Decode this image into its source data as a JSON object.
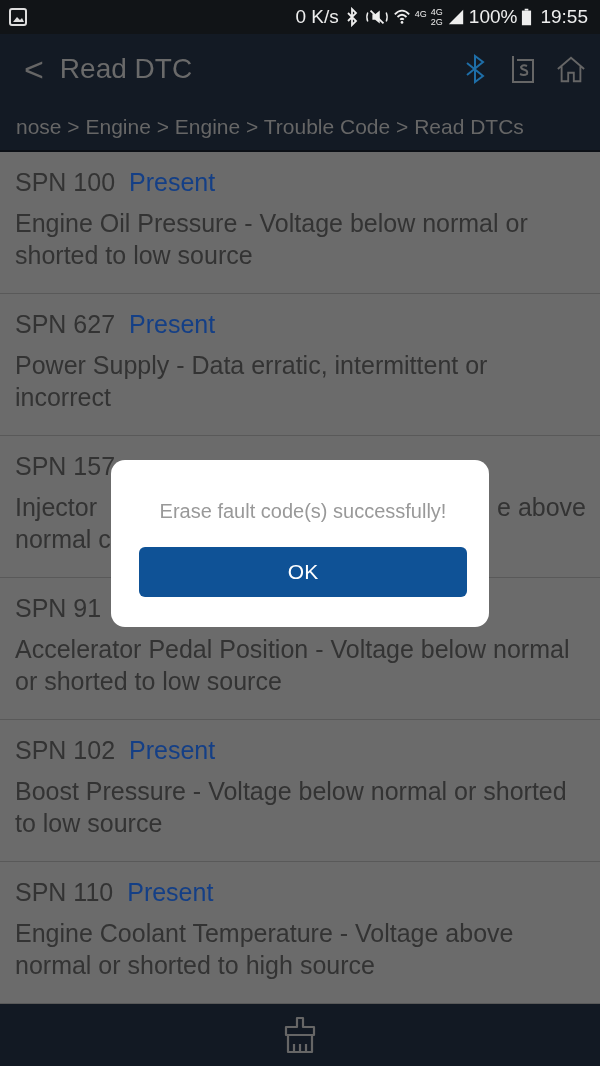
{
  "status_bar": {
    "speed": "0 K/s",
    "network_1": "4G",
    "network_2_top": "4G",
    "network_2_bottom": "2G",
    "battery": "100%",
    "time": "19:55"
  },
  "header": {
    "back_icon": "<",
    "title": "Read DTC",
    "bluetooth_connected": true
  },
  "breadcrumb": "nose > Engine > Engine > Trouble Code > Read DTCs",
  "codes": [
    {
      "kind": "full",
      "code": "SPN 100",
      "status": "Present",
      "description": "Engine Oil Pressure - Voltage below normal or shorted to low source"
    },
    {
      "kind": "full",
      "code": "SPN 627",
      "status": "Present",
      "description": "Power Supply - Data erratic, intermittent or incorrect"
    },
    {
      "kind": "covered",
      "code": "SPN 157",
      "left_line_1": "Injector",
      "right_line_1": "e above",
      "left_line_2": "normal c"
    },
    {
      "kind": "covered_status",
      "code": "SPN 91",
      "description": "Accelerator Pedal Position - Voltage below normal or shorted to low source"
    },
    {
      "kind": "full",
      "code": "SPN 102",
      "status": "Present",
      "description": "Boost Pressure - Voltage below normal or shorted to low source"
    },
    {
      "kind": "full",
      "code": "SPN 110",
      "status": "Present",
      "description": "Engine Coolant Temperature - Voltage above normal or shorted to high source"
    }
  ],
  "dialog": {
    "message": "Erase fault code(s) successfully!",
    "button": "OK"
  }
}
